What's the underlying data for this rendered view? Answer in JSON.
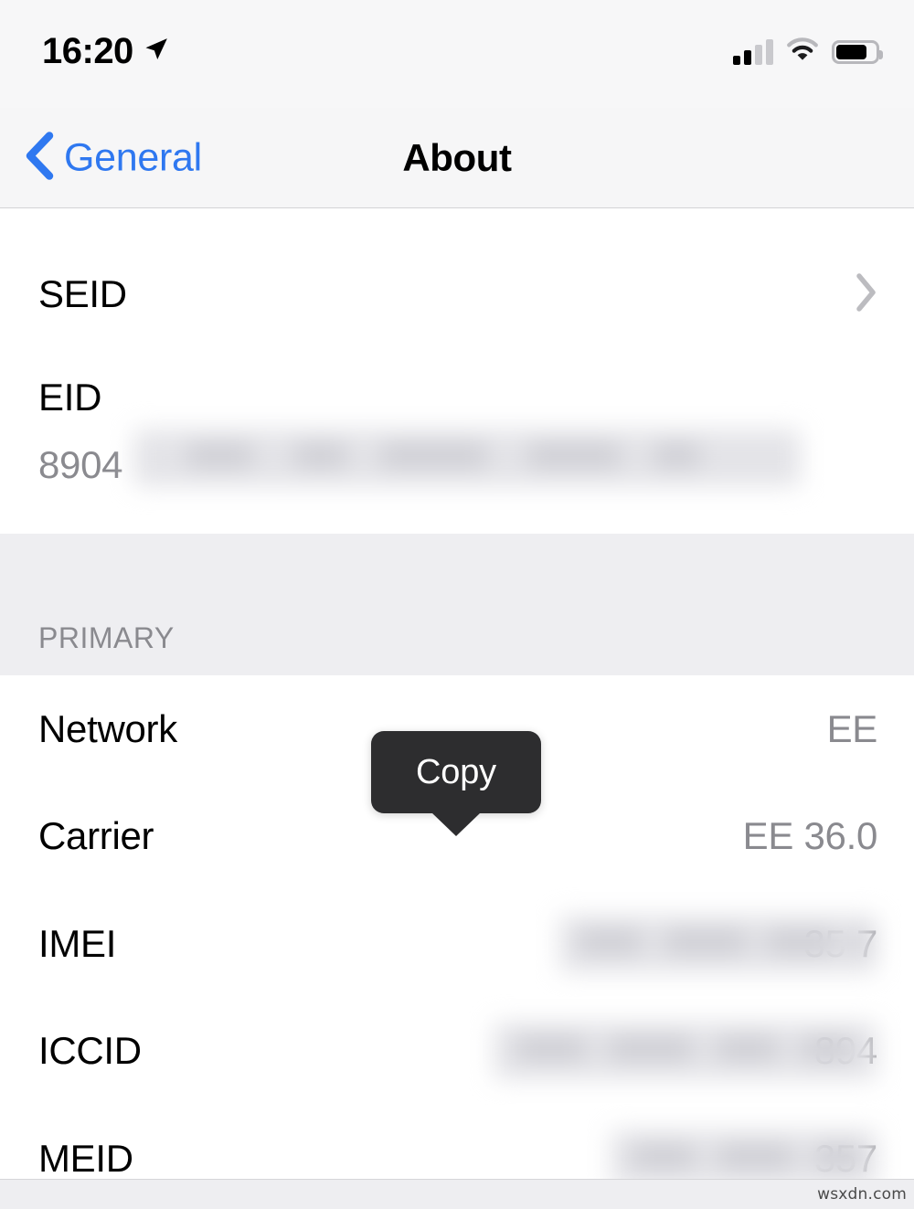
{
  "status_bar": {
    "time": "16:20",
    "location_icon": "location-arrow-icon",
    "signal_icon": "cellular-signal-icon",
    "signal_bars_filled": 2,
    "signal_bars_total": 4,
    "wifi_icon": "wifi-icon",
    "battery_icon": "battery-icon",
    "battery_percent": 75
  },
  "nav": {
    "back_label": "General",
    "back_icon": "chevron-left-icon",
    "title": "About"
  },
  "sections": [
    {
      "id": "device-ids",
      "header": null,
      "rows": [
        {
          "type": "disclosure",
          "name": "seid",
          "label": "SEID",
          "value": "",
          "accessory": "chevron-right-icon"
        },
        {
          "type": "stacked",
          "name": "eid",
          "label": "EID",
          "value": "8904",
          "redacted": true
        }
      ]
    },
    {
      "id": "primary",
      "header": "PRIMARY",
      "rows": [
        {
          "type": "value",
          "name": "network",
          "label": "Network",
          "value": "EE",
          "redacted": false
        },
        {
          "type": "value",
          "name": "carrier",
          "label": "Carrier",
          "value": "EE 36.0",
          "redacted": false
        },
        {
          "type": "value",
          "name": "imei",
          "label": "IMEI",
          "value": "35 7",
          "redacted": true
        },
        {
          "type": "value",
          "name": "iccid",
          "label": "ICCID",
          "value": "894",
          "redacted": true
        },
        {
          "type": "value",
          "name": "meid",
          "label": "MEID",
          "value": "357",
          "redacted": true
        }
      ]
    }
  ],
  "tooltip": {
    "label": "Copy"
  },
  "watermark": "wsxdn.com",
  "colors": {
    "accent_blue": "#2f78f0",
    "value_gray": "#8a8a8f",
    "separator": "#d6d6d9",
    "group_gray": "#eeeef1",
    "navbar_bg": "#f6f6f7",
    "tooltip_bg": "#2d2d2f"
  }
}
